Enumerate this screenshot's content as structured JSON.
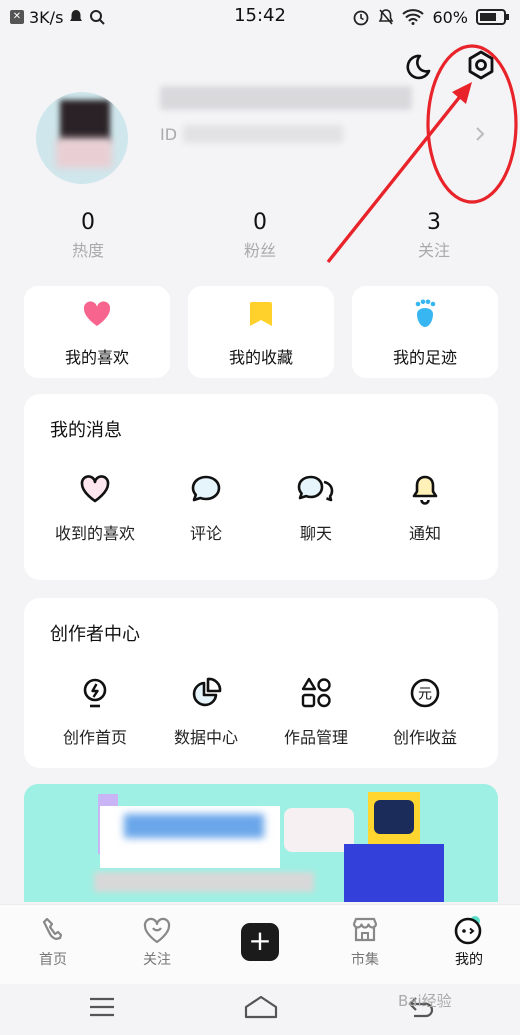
{
  "status_bar": {
    "net_speed": "3K/s",
    "time": "15:42",
    "battery": "60%",
    "icons": [
      "app-icon",
      "notification-icon",
      "search-icon",
      "alarm-icon",
      "mute-icon",
      "wifi-icon",
      "battery-icon"
    ]
  },
  "header": {
    "moon_icon": "moon-icon",
    "settings_icon": "settings-icon",
    "id_label": "ID"
  },
  "stats": [
    {
      "value": "0",
      "label": "热度"
    },
    {
      "value": "0",
      "label": "粉丝"
    },
    {
      "value": "3",
      "label": "关注"
    }
  ],
  "quick_cards": [
    {
      "label": "我的喜欢",
      "icon": "heart-icon",
      "color": "#f7658f"
    },
    {
      "label": "我的收藏",
      "icon": "bookmark-icon",
      "color": "#ffd12a"
    },
    {
      "label": "我的足迹",
      "icon": "footprint-icon",
      "color": "#37b6f2"
    }
  ],
  "messages": {
    "title": "我的消息",
    "items": [
      {
        "label": "收到的喜欢",
        "icon": "heart-outline-icon"
      },
      {
        "label": "评论",
        "icon": "comment-icon"
      },
      {
        "label": "聊天",
        "icon": "chat-icon"
      },
      {
        "label": "通知",
        "icon": "bell-icon"
      }
    ]
  },
  "creator": {
    "title": "创作者中心",
    "items": [
      {
        "label": "创作首页",
        "icon": "bulb-icon"
      },
      {
        "label": "数据中心",
        "icon": "pie-chart-icon"
      },
      {
        "label": "作品管理",
        "icon": "shapes-icon"
      },
      {
        "label": "创作收益",
        "icon": "yuan-icon",
        "glyph": "元"
      }
    ]
  },
  "tabbar": {
    "items": [
      {
        "label": "首页",
        "icon": "home-icon"
      },
      {
        "label": "关注",
        "icon": "follow-icon"
      },
      {
        "label": "",
        "icon": "plus-icon",
        "glyph": "+"
      },
      {
        "label": "市集",
        "icon": "market-icon"
      },
      {
        "label": "我的",
        "icon": "profile-icon"
      }
    ],
    "active": "我的"
  },
  "watermark": "Bai经验",
  "colors": {
    "annotation_red": "#e8232a",
    "banner_bg": "#9ff0e4",
    "yellow_accent": "#ffd12a"
  }
}
